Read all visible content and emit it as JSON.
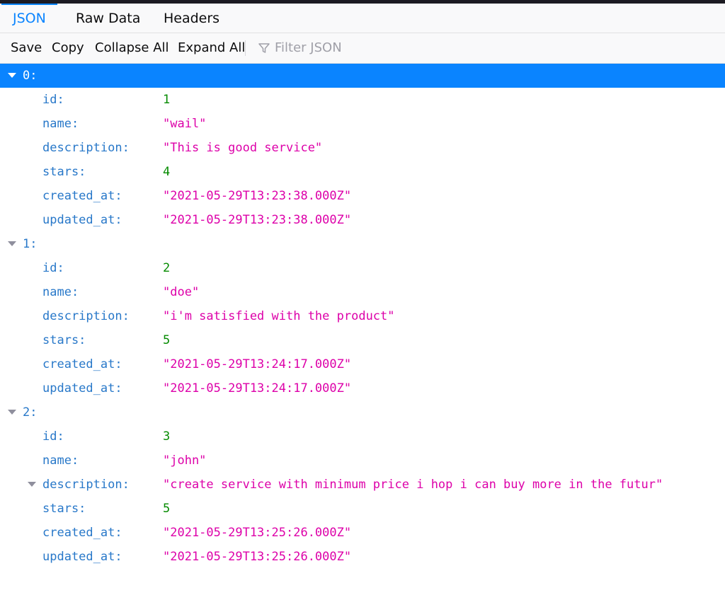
{
  "tabs": [
    {
      "label": "JSON"
    },
    {
      "label": "Raw Data"
    },
    {
      "label": "Headers"
    }
  ],
  "toolbar": {
    "save": "Save",
    "copy": "Copy",
    "collapse_all": "Collapse All",
    "expand_all": "Expand All",
    "filter_placeholder": "Filter JSON"
  },
  "records": [
    {
      "index": "0:",
      "fields": {
        "id": {
          "key": "id:",
          "value": "1"
        },
        "name": {
          "key": "name:",
          "value": "\"wail\""
        },
        "description": {
          "key": "description:",
          "value": "\"This is good service\""
        },
        "stars": {
          "key": "stars:",
          "value": "4"
        },
        "created_at": {
          "key": "created_at:",
          "value": "\"2021-05-29T13:23:38.000Z\""
        },
        "updated_at": {
          "key": "updated_at:",
          "value": "\"2021-05-29T13:23:38.000Z\""
        }
      }
    },
    {
      "index": "1:",
      "fields": {
        "id": {
          "key": "id:",
          "value": "2"
        },
        "name": {
          "key": "name:",
          "value": "\"doe\""
        },
        "description": {
          "key": "description:",
          "value": "\"i'm satisfied with the product\""
        },
        "stars": {
          "key": "stars:",
          "value": "5"
        },
        "created_at": {
          "key": "created_at:",
          "value": "\"2021-05-29T13:24:17.000Z\""
        },
        "updated_at": {
          "key": "updated_at:",
          "value": "\"2021-05-29T13:24:17.000Z\""
        }
      }
    },
    {
      "index": "2:",
      "fields": {
        "id": {
          "key": "id:",
          "value": "3"
        },
        "name": {
          "key": "name:",
          "value": "\"john\""
        },
        "description": {
          "key": "description:",
          "value": "\"create service with minimum price i hop i can buy more in the futur\""
        },
        "stars": {
          "key": "stars:",
          "value": "5"
        },
        "created_at": {
          "key": "created_at:",
          "value": "\"2021-05-29T13:25:26.000Z\""
        },
        "updated_at": {
          "key": "updated_at:",
          "value": "\"2021-05-29T13:25:26.000Z\""
        }
      }
    }
  ],
  "colors": {
    "accent": "#0a84ff",
    "key": "#2878c9",
    "number": "#058b00",
    "string": "#dd00a9"
  }
}
